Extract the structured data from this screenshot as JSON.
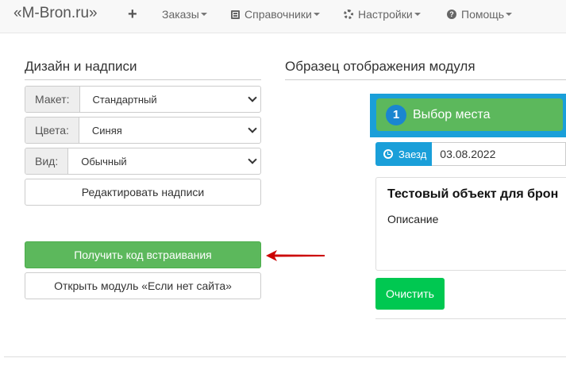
{
  "navbar": {
    "brand": "«M-Bron.ru»",
    "orders": "Заказы",
    "references": "Справочники",
    "settings": "Настройки",
    "help": "Помощь"
  },
  "design": {
    "title": "Дизайн и надписи",
    "layout_label": "Макет:",
    "layout_value": "Стандартный",
    "colors_label": "Цвета:",
    "colors_value": "Синяя",
    "view_label": "Вид:",
    "view_value": "Обычный",
    "edit_labels_button": "Редактировать надписи",
    "get_code_button": "Получить код встраивания",
    "open_module_button": "Открыть модуль «Если нет сайта»"
  },
  "preview": {
    "title": "Образец отображения модуля",
    "step_number": "1",
    "step_label": "Выбор места",
    "checkin_label": "Заезд",
    "checkin_date": "03.08.2022",
    "object_title": "Тестовый объект для брон",
    "description": "Описание",
    "clear_button": "Очистить"
  },
  "colors": {
    "accent_blue": "#1a9fd9",
    "success_green": "#5cb85c",
    "clear_green": "#00c851",
    "arrow_red": "#cc0000"
  }
}
